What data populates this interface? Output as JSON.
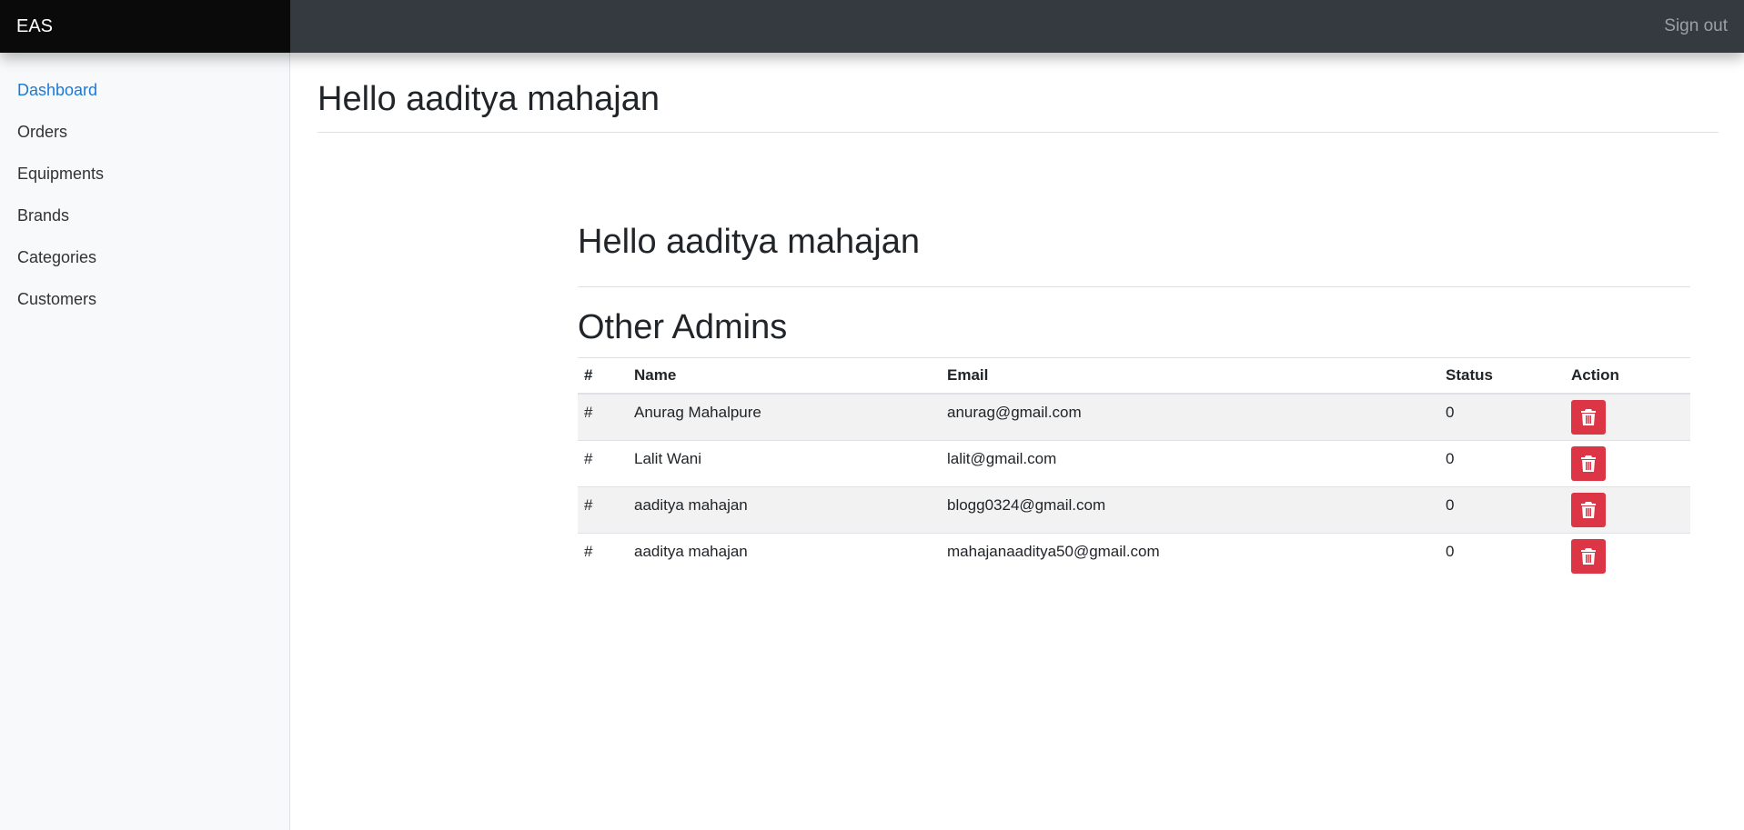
{
  "navbar": {
    "brand": "EAS",
    "signout_label": "Sign out"
  },
  "sidebar": {
    "items": [
      {
        "label": "Dashboard",
        "active": true
      },
      {
        "label": "Orders"
      },
      {
        "label": "Equipments"
      },
      {
        "label": "Brands"
      },
      {
        "label": "Categories"
      },
      {
        "label": "Customers"
      }
    ]
  },
  "main": {
    "title": "Hello aaditya mahajan",
    "greeting": "Hello aaditya mahajan",
    "admins_heading": "Other Admins"
  },
  "table": {
    "headers": [
      "#",
      "Name",
      "Email",
      "Status",
      "Action"
    ],
    "rows": [
      {
        "num": "#",
        "name": "Anurag Mahalpure",
        "email": "anurag@gmail.com",
        "status": "0",
        "action_icon": "trash-icon"
      },
      {
        "num": "#",
        "name": "Lalit Wani",
        "email": "lalit@gmail.com",
        "status": "0",
        "action_icon": "trash-icon"
      },
      {
        "num": "#",
        "name": "aaditya mahajan",
        "email": "blogg0324@gmail.com",
        "status": "0",
        "action_icon": "trash-icon"
      },
      {
        "num": "#",
        "name": "aaditya mahajan",
        "email": "mahajanaaditya50@gmail.com",
        "status": "0",
        "action_icon": "trash-icon"
      }
    ]
  },
  "colors": {
    "danger": "#dc3545",
    "link_active": "#1a7ad8",
    "navbar": "#343a40",
    "brand_bg": "#0a0a0b"
  }
}
